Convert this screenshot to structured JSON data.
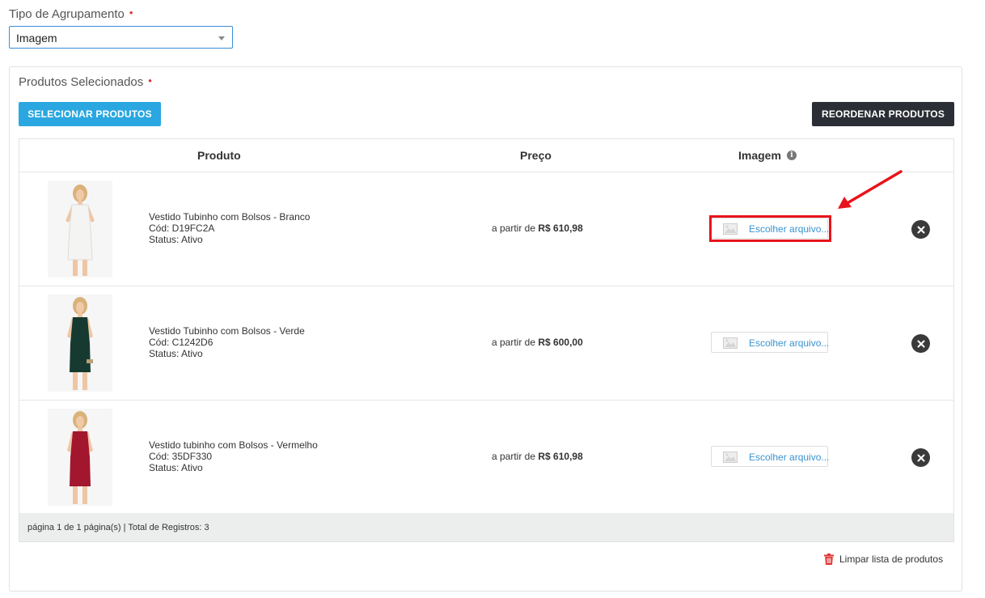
{
  "group": {
    "label": "Tipo de Agrupamento",
    "required_mark": "•",
    "selected": "Imagem"
  },
  "products_panel": {
    "title": "Produtos Selecionados",
    "required_mark": "•",
    "select_button": "SELECIONAR PRODUTOS",
    "reorder_button": "REORDENAR PRODUTOS"
  },
  "table": {
    "headers": {
      "produto": "Produto",
      "preco": "Preço",
      "imagem": "Imagem",
      "info_icon": "i"
    },
    "rows": [
      {
        "name": "Vestido Tubinho com Bolsos - Branco",
        "code": "Cód: D19FC2A",
        "status": "Status: Ativo",
        "price_prefix": "a partir de",
        "price": "R$ 610,98",
        "file_button": "Escolher arquivo...",
        "dress_color": "#f4f4f2"
      },
      {
        "name": "Vestido Tubinho com Bolsos - Verde",
        "code": "Cód: C1242D6",
        "status": "Status: Ativo",
        "price_prefix": "a partir de",
        "price": "R$ 600,00",
        "file_button": "Escolher arquivo...",
        "dress_color": "#163a30"
      },
      {
        "name": "Vestido tubinho com Bolsos - Vermelho",
        "code": "Cód: 35DF330",
        "status": "Status: Ativo",
        "price_prefix": "a partir de",
        "price": "R$ 610,98",
        "file_button": "Escolher arquivo...",
        "dress_color": "#a2172e"
      }
    ],
    "footer": "página 1 de 1 página(s) | Total de Registros: 3"
  },
  "clear_link": "Limpar lista de produtos",
  "colors": {
    "primary_button": "#2aa7e0",
    "dark_button": "#2b2e35",
    "highlight": "#e8141b",
    "link": "#3a93cf"
  },
  "icons": {
    "select_caret": "chevron-down-icon",
    "info": "info-icon",
    "file_image": "image-icon",
    "remove": "close-icon",
    "clear": "trash-icon",
    "annotation": "arrow-icon"
  }
}
